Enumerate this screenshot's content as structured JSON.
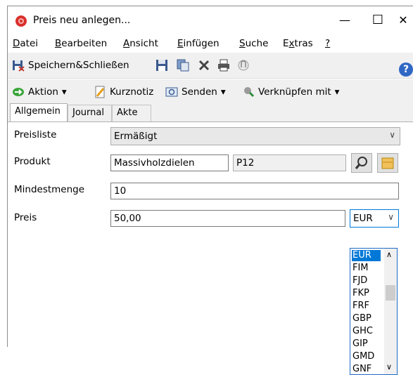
{
  "window": {
    "title": "Preis neu anlegen...",
    "min": "—",
    "max": "☐",
    "close": "✕"
  },
  "menu": [
    {
      "pre": "",
      "acc": "D",
      "post": "atei"
    },
    {
      "pre": "",
      "acc": "B",
      "post": "earbeiten"
    },
    {
      "pre": "",
      "acc": "A",
      "post": "nsicht"
    },
    {
      "pre": "",
      "acc": "E",
      "post": "infügen"
    },
    {
      "pre": "",
      "acc": "S",
      "post": "uche"
    },
    {
      "pre": "E",
      "acc": "x",
      "post": "tras"
    },
    {
      "pre": "",
      "acc": "?",
      "post": ""
    }
  ],
  "toolbar1": {
    "save_close": "Speichern&Schließen",
    "help": "?"
  },
  "toolbar2": {
    "action": "Aktion",
    "note": "Kurznotiz",
    "send": "Senden",
    "link": "Verknüpfen mit",
    "caret": "▾"
  },
  "tabs": [
    "Allgemein",
    "Journal",
    "Akte"
  ],
  "form": {
    "pricelist_label": "Preisliste",
    "pricelist_value": "Ermäßigt",
    "product_label": "Produkt",
    "product_name": "Massivholzdielen",
    "product_code": "P12",
    "minqty_label": "Mindestmenge",
    "minqty_value": "10",
    "price_label": "Preis",
    "price_value": "50,00",
    "currency_value": "EUR",
    "chevron": "∨"
  },
  "currency_options": [
    "EUR",
    "FIM",
    "FJD",
    "FKP",
    "FRF",
    "GBP",
    "GHC",
    "GIP",
    "GMD",
    "GNF"
  ],
  "scroll": {
    "up": "∧",
    "down": "∨"
  }
}
